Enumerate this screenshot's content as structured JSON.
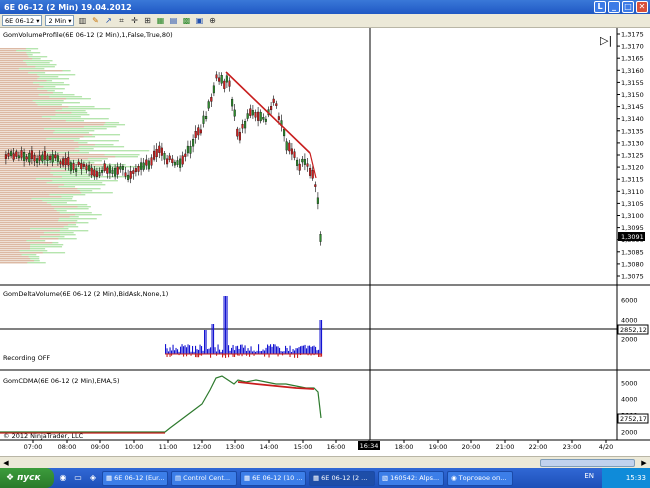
{
  "window": {
    "title": "6E 06-12 (2 Min)  19.04.2012",
    "buttons": [
      "L",
      "_",
      "□",
      "✕"
    ]
  },
  "toolbar": {
    "instrument": "6E 06-12",
    "interval": "2 Min"
  },
  "chart": {
    "panel1_label": "GomVolumeProfile(6E 06-12 (2 Min),1,False,True,80)",
    "panel2_label": "GomDeltaVolume(6E 06-12 (2 Min),BidAsk,None,1)",
    "panel2_status": "Recording OFF",
    "panel3_label": "GomCDMA(6E 06-12 (2 Min),EMA,5)",
    "copyright": "© 2012 NinjaTrader, LLC",
    "price_ticks": [
      "1,3175",
      "1,3170",
      "1,3165",
      "1,3160",
      "1,3155",
      "1,3150",
      "1,3145",
      "1,3140",
      "1,3135",
      "1,3130",
      "1,3125",
      "1,3120",
      "1,3115",
      "1,3110",
      "1,3105",
      "1,3100",
      "1,3095",
      "1,3090",
      "1,3085",
      "1,3080",
      "1,3075"
    ],
    "price_current": "1,3091",
    "delta_ticks": [
      "6000",
      "4000",
      "2000"
    ],
    "delta_current": "2852,12",
    "cdma_ticks": [
      "5000",
      "4000",
      "3000",
      "2000"
    ],
    "cdma_current": "2752,17",
    "time_ticks": [
      "07:00",
      "08:00",
      "09:00",
      "10:00",
      "11:00",
      "12:00",
      "13:00",
      "14:00",
      "15:00",
      "16:00",
      "16:34",
      "18:00",
      "19:00",
      "20:00",
      "21:00",
      "22:00",
      "23:00",
      "4/20"
    ],
    "cursor_time": "16:34",
    "colors": {
      "up": "#2d8a2d",
      "down": "#c81e1e",
      "trend": "#c81e1e",
      "profile_red": "#f4a0a0",
      "profile_green": "#a8e0a0",
      "delta": "#1414d2"
    }
  },
  "taskbar": {
    "start_label": "пуск",
    "tasks": [
      "6E 06-12 (Eur...",
      "Control Cent...",
      "6E 06-12 (10 ...",
      "6E 06-12 (2 ...",
      "160542: Alps...",
      "Торговое оп..."
    ],
    "lang": "EN",
    "clock": "15:33"
  }
}
